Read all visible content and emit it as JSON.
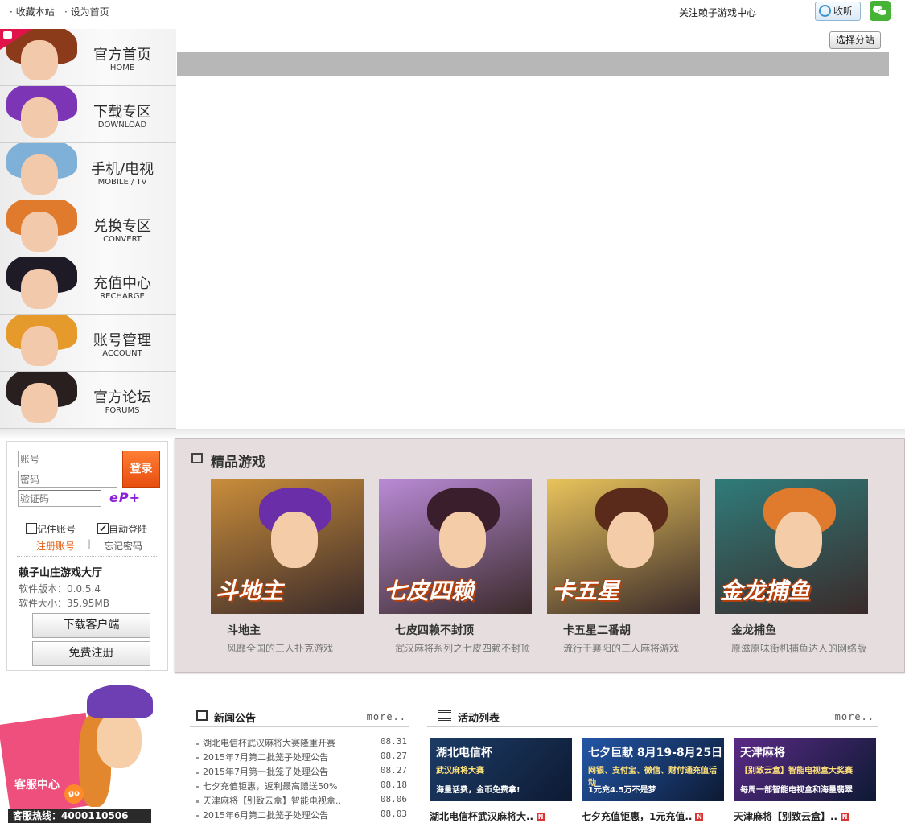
{
  "topbar": {
    "bookmark": "收藏本站",
    "homepage": "设为首页",
    "follow": "关注赖子游戏中心",
    "listen": "收听",
    "select_site": "选择分站"
  },
  "nav": [
    {
      "cn": "官方首页",
      "en": "HOME",
      "hair": "#8b3a1a"
    },
    {
      "cn": "下载专区",
      "en": "DOWNLOAD",
      "hair": "#7b35b5"
    },
    {
      "cn": "手机/电视",
      "en": "MOBILE / TV",
      "hair": "#7fb0d8"
    },
    {
      "cn": "兑换专区",
      "en": "CONVERT",
      "hair": "#e07a2c"
    },
    {
      "cn": "充值中心",
      "en": "RECHARGE",
      "hair": "#1e1a26"
    },
    {
      "cn": "账号管理",
      "en": "ACCOUNT",
      "hair": "#e59a2b"
    },
    {
      "cn": "官方论坛",
      "en": "FORUMS",
      "hair": "#2a1f1f"
    }
  ],
  "login": {
    "account_placeholder": "账号",
    "password_placeholder": "密码",
    "captcha_placeholder": "验证码",
    "captcha_text": "eP+",
    "login_button": "登录",
    "remember": "记住账号",
    "remember_checked": false,
    "auto_login": "自动登陆",
    "auto_login_checked": true,
    "register_link": "注册账号",
    "separator": "|",
    "forgot": "忘记密码",
    "app_title": "赖子山庄游戏大厅",
    "version": "软件版本：0.0.5.4",
    "size": "软件大小：35.95MB",
    "download_button": "下载客户端",
    "register_button": "免费注册"
  },
  "promo": {
    "service": "客服中心",
    "go": "go",
    "hotline": "客服热线：4000110506"
  },
  "games": {
    "title": "精品游戏",
    "items": [
      {
        "name": "斗地主",
        "desc": "风靡全国的三人扑克游戏",
        "logo": "斗地主",
        "bg": "#c98d3a",
        "hair": "#6a2fa8"
      },
      {
        "name": "七皮四赖不封顶",
        "desc": "武汉麻将系列之七皮四赖不封顶",
        "logo": "七皮四赖",
        "bg": "#b98ad6",
        "hair": "#3a1e2c"
      },
      {
        "name": "卡五星二番胡",
        "desc": "流行于襄阳的三人麻将游戏",
        "logo": "卡五星",
        "bg": "#e8c35b",
        "hair": "#5a2a1a"
      },
      {
        "name": "金龙捕鱼",
        "desc": "原滋原味街机捕鱼达人的网络版",
        "logo": "金龙捕鱼",
        "bg": "#2f7c7a",
        "hair": "#e07a2c"
      }
    ]
  },
  "news": {
    "title": "新闻公告",
    "more": "more..",
    "items": [
      {
        "text": "湖北电信杯武汉麻将大赛隆重开赛",
        "date": "08.31"
      },
      {
        "text": "2015年7月第二批笼子处理公告",
        "date": "08.27"
      },
      {
        "text": "2015年7月第一批笼子处理公告",
        "date": "08.27"
      },
      {
        "text": "七夕充值钜惠，返利最高赠送50%",
        "date": "08.18"
      },
      {
        "text": "天津麻将【别致云盒】智能电视盒..",
        "date": "08.06"
      },
      {
        "text": "2015年6月第二批笼子处理公告",
        "date": "08.03"
      }
    ]
  },
  "activities": {
    "title": "活动列表",
    "more": "more..",
    "items": [
      {
        "caption": "湖北电信杯武汉麻将大..",
        "line1": "湖北电信杯",
        "line2": "武汉麻将大赛",
        "line3": "海量话费，金币免费拿!",
        "bg": "#1d3c66",
        "new": "N"
      },
      {
        "caption": "七夕充值钜惠，1元充值..",
        "line1": "七夕巨献 8月19-8月25日",
        "line2": "网银、支付宝、微信、财付通充值活动",
        "line3": "1元充4.5万不是梦",
        "bg": "#2357a8",
        "new": "N"
      },
      {
        "caption": "天津麻将【别致云盒】..",
        "line1": "天津麻将",
        "line2": "【别致云盒】智能电视盒大奖赛",
        "line3": "每周一部智能电视盒和海量翡翠",
        "bg": "#5b2a86",
        "new": "N"
      }
    ]
  }
}
